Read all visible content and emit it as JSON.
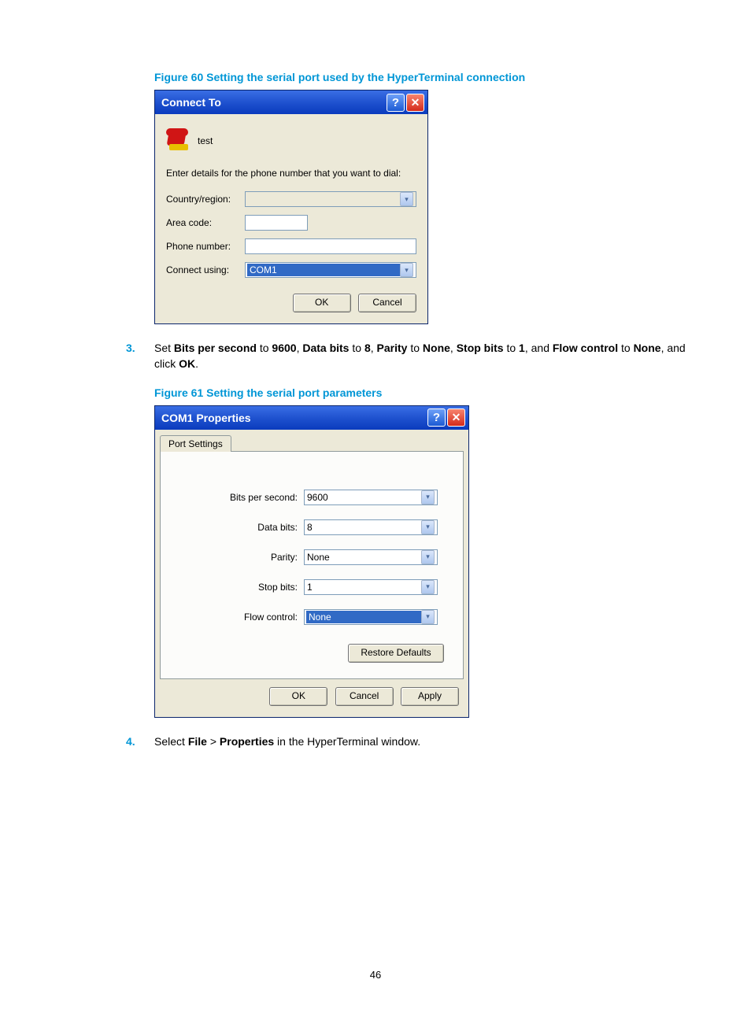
{
  "figure60_caption": "Figure 60 Setting the serial port used by the HyperTerminal connection",
  "figure61_caption": "Figure 61 Setting the serial port parameters",
  "step3": {
    "num": "3.",
    "p1": "Set ",
    "b1": "Bits per second",
    "p2": " to ",
    "b2": "9600",
    "p3": ", ",
    "b3": "Data bits",
    "p4": " to ",
    "b4": "8",
    "p5": ", ",
    "b5": "Parity",
    "p6": " to ",
    "b6": "None",
    "p7": ", ",
    "b7": "Stop bits",
    "p8": " to ",
    "b8": "1",
    "p9": ", and ",
    "b9": "Flow control",
    "p10": " to ",
    "b10": "None",
    "p11": ", and click ",
    "b11": "OK",
    "p12": "."
  },
  "step4": {
    "num": "4.",
    "p1": "Select ",
    "b1": "File",
    "p2": " > ",
    "b2": "Properties",
    "p3": " in the HyperTerminal window."
  },
  "connect_to": {
    "title": "Connect To",
    "name": "test",
    "instruction": "Enter details for the phone number that you want to dial:",
    "labels": {
      "country": "Country/region:",
      "area": "Area code:",
      "phone": "Phone number:",
      "using": "Connect using:"
    },
    "using_value": "COM1",
    "ok": "OK",
    "cancel": "Cancel"
  },
  "com1": {
    "title": "COM1 Properties",
    "tab": "Port Settings",
    "labels": {
      "bps": "Bits per second:",
      "databits": "Data bits:",
      "parity": "Parity:",
      "stopbits": "Stop bits:",
      "flow": "Flow control:"
    },
    "values": {
      "bps": "9600",
      "databits": "8",
      "parity": "None",
      "stopbits": "1",
      "flow": "None"
    },
    "restore": "Restore Defaults",
    "ok": "OK",
    "cancel": "Cancel",
    "apply": "Apply"
  },
  "page_number": "46"
}
